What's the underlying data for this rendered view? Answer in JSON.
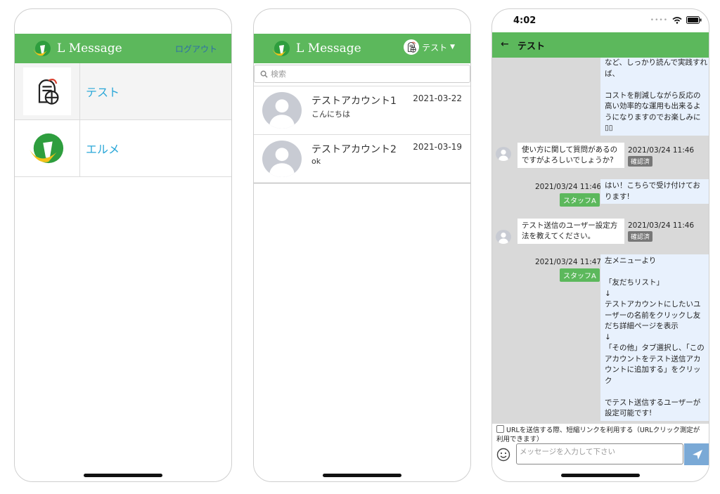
{
  "brand": {
    "name": "L Message"
  },
  "screen1": {
    "logout_label": "ログアウト",
    "accounts": [
      {
        "name": "テスト"
      },
      {
        "name": "エルメ"
      }
    ]
  },
  "screen2": {
    "user_label": "テスト",
    "search_placeholder": "検索",
    "chats": [
      {
        "name": "テストアカウント1",
        "last_message": "こんにちは",
        "date": "2021-03-22"
      },
      {
        "name": "テストアカウント2",
        "last_message": "ok",
        "date": "2021-03-19"
      }
    ]
  },
  "screen3": {
    "status_time": "4:02",
    "title": "テスト",
    "messages": {
      "m1_text": "など、しっかり読んで実践すれば、\n\nコストを削減しながら反応の高い効率的な運用も出来るようになりますのでお楽しみに▯▯",
      "m2_text": "使い方に関して質問があるのですがよろしいでしょうか?",
      "m2_time": "2021/03/24 11:46",
      "m2_status": "確認済",
      "m3_text": "はい！こちらで受け付けております!",
      "m3_time": "2021/03/24 11:46",
      "m3_staff": "スタッフA",
      "m4_text": "テスト送信のユーザー設定方法を教えてください。",
      "m4_time": "2021/03/24 11:46",
      "m4_status": "確認済",
      "m5_text": "左メニューより\n\n「友だちリスト」\n↓\nテストアカウントにしたいユーザーの名前をクリックし友だち詳細ページを表示\n↓\n「その他」タブ選択し、「このアカウントをテスト送信アカウントに追加する」をクリック\n\nでテスト送信するユーザーが設定可能です!",
      "m5_time": "2021/03/24 11:47",
      "m5_staff": "スタッフA"
    },
    "url_option_label": "URLを送信する際、短縮リンクを利用する（URLクリック測定が利用できます）",
    "input_placeholder": "メッセージを入力して下さい"
  },
  "colors": {
    "header_green": "#5cb85c",
    "link_blue": "#2aa7d8",
    "bubble_blue": "#e8f1fd",
    "send_blue": "#7aa9d6"
  }
}
